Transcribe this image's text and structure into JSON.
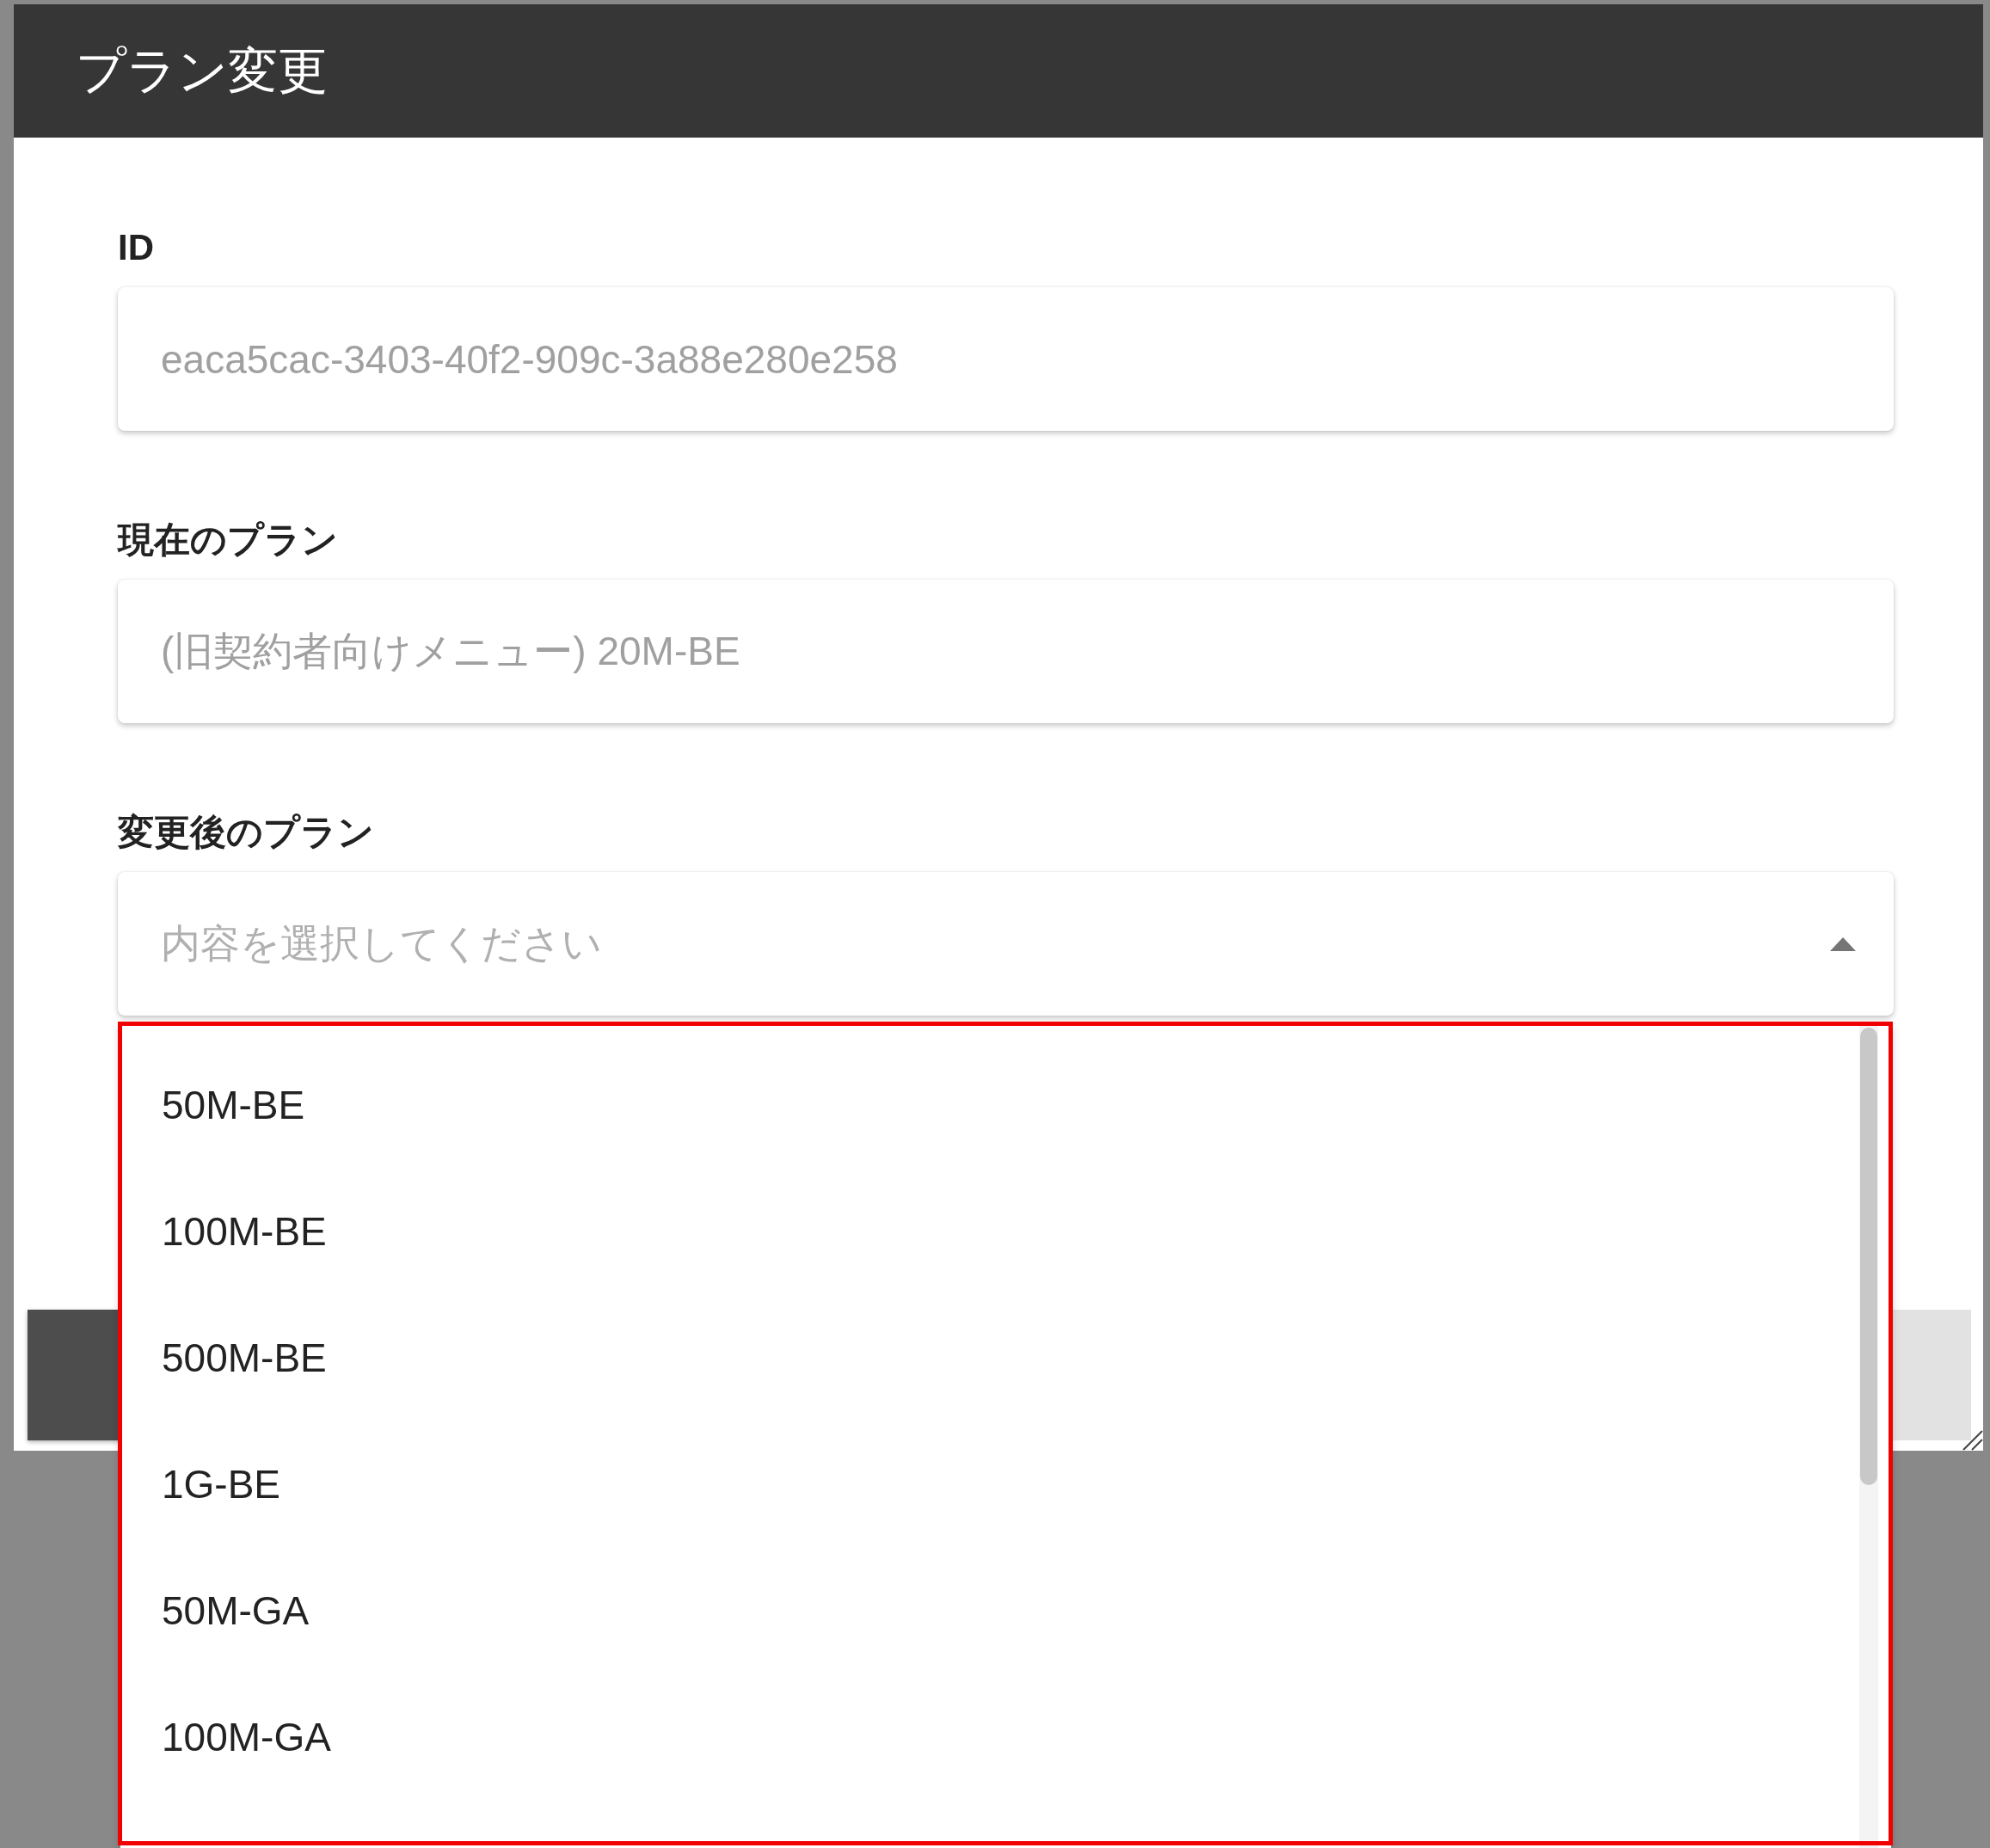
{
  "dialog": {
    "title": "プラン変更"
  },
  "fields": [
    {
      "label": "ID",
      "value": "eaca5cac-3403-40f2-909c-3a88e280e258",
      "disabled": true
    },
    {
      "label": "現在のプラン",
      "value": "(旧契約者向けメニュー) 20M-BE",
      "disabled": true
    }
  ],
  "select": {
    "label": "変更後のプラン",
    "placeholder": "内容を選択してください",
    "expanded": true
  },
  "options": [
    {
      "label": "50M-BE",
      "selected": false
    },
    {
      "label": "100M-BE",
      "selected": false
    },
    {
      "label": "500M-BE",
      "selected": false
    },
    {
      "label": "1G-BE",
      "selected": false
    },
    {
      "label": "50M-GA",
      "selected": false
    },
    {
      "label": "100M-GA",
      "selected": false
    }
  ]
}
